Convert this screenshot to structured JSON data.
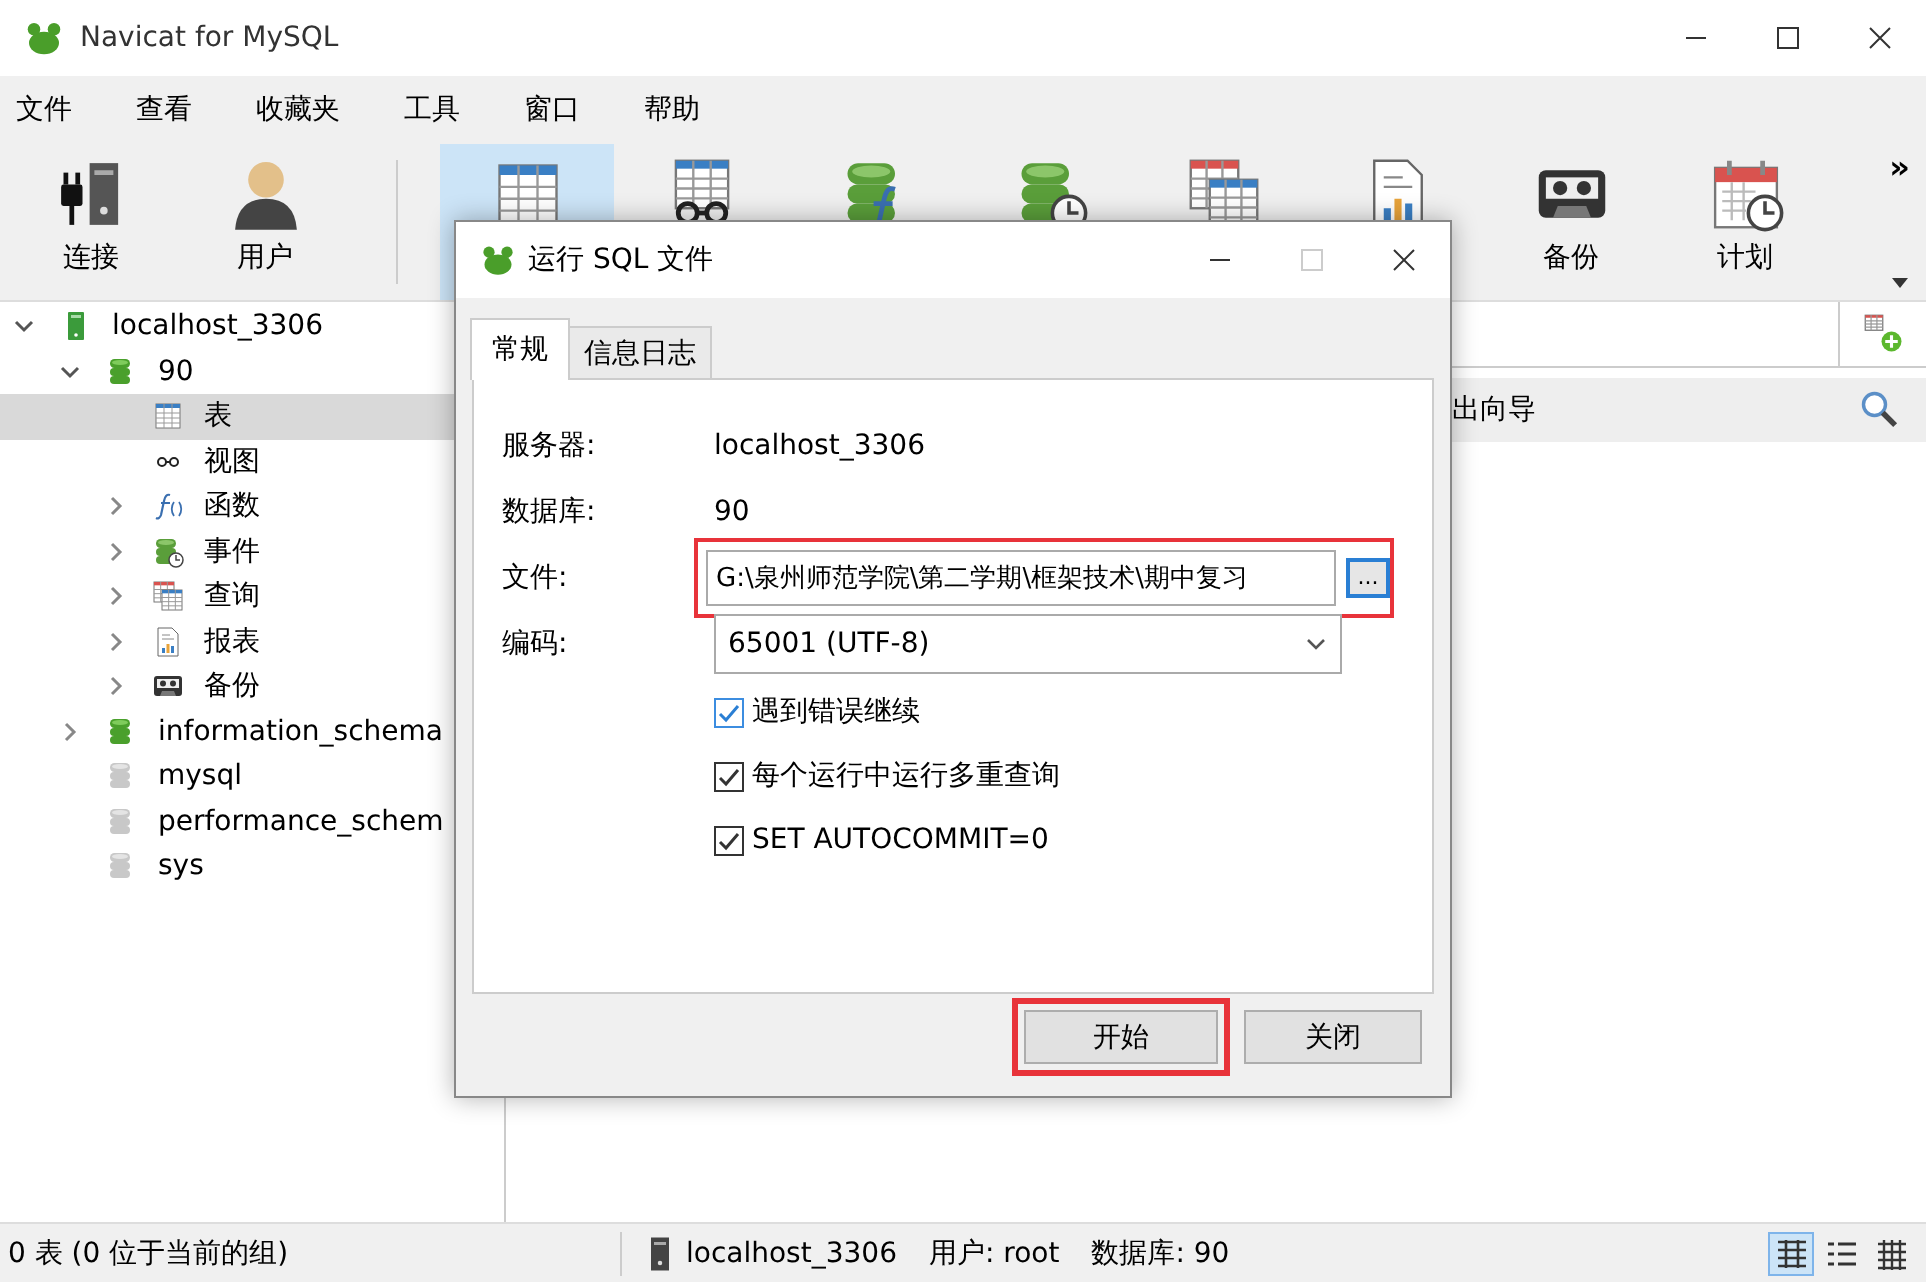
{
  "window": {
    "title": "Navicat for MySQL"
  },
  "menu": [
    "文件",
    "查看",
    "收藏夹",
    "工具",
    "窗口",
    "帮助"
  ],
  "toolbar": {
    "items": [
      {
        "kind": "connection",
        "label": "连接",
        "selected": false
      },
      {
        "kind": "user",
        "label": "用户",
        "selected": false
      },
      {
        "kind": "table",
        "selected": true
      },
      {
        "kind": "view",
        "selected": false
      },
      {
        "kind": "function",
        "selected": false
      },
      {
        "kind": "event",
        "selected": false
      },
      {
        "kind": "query",
        "selected": false
      },
      {
        "kind": "report",
        "selected": false
      },
      {
        "kind": "backup",
        "label": "备份",
        "selected": false
      },
      {
        "kind": "schedule",
        "label": "计划",
        "selected": false
      }
    ],
    "overflow": "»"
  },
  "tree": [
    {
      "label": "localhost_3306",
      "kind": "server",
      "expanded": true,
      "selected": false,
      "children": [
        {
          "label": "90",
          "kind": "database",
          "expanded": true,
          "selected": false,
          "children": [
            {
              "label": "表",
              "kind": "table",
              "selected": true
            },
            {
              "label": "视图",
              "kind": "view",
              "selected": false
            },
            {
              "label": "函数",
              "kind": "function",
              "expanded": false,
              "selected": false
            },
            {
              "label": "事件",
              "kind": "event",
              "expanded": false,
              "selected": false
            },
            {
              "label": "查询",
              "kind": "query",
              "expanded": false,
              "selected": false
            },
            {
              "label": "报表",
              "kind": "report",
              "expanded": false,
              "selected": false
            },
            {
              "label": "备份",
              "kind": "backup",
              "expanded": false,
              "selected": false
            }
          ]
        },
        {
          "label": "information_schema",
          "kind": "database",
          "expanded": false,
          "selected": false
        },
        {
          "label": "mysql",
          "kind": "database-closed",
          "selected": false
        },
        {
          "label": "performance_schem",
          "kind": "database-closed",
          "selected": false
        },
        {
          "label": "sys",
          "kind": "database-closed",
          "selected": false
        }
      ]
    }
  ],
  "object_bar": {
    "label": "出向导"
  },
  "dialog": {
    "title": "运行 SQL 文件",
    "tabs": [
      {
        "label": "常规",
        "selected": true
      },
      {
        "label": "信息日志",
        "selected": false
      }
    ],
    "fields": [
      {
        "kind": "text",
        "label": "服务器:",
        "value": "localhost_3306",
        "highlighted": false
      },
      {
        "kind": "text",
        "label": "数据库:",
        "value": "90",
        "highlighted": false
      },
      {
        "kind": "file",
        "label": "文件:",
        "value": "G:\\泉州师范学院\\第二学期\\框架技术\\期中复习",
        "browse": "...",
        "highlighted": true
      },
      {
        "kind": "select",
        "label": "编码:",
        "value": "65001 (UTF-8)",
        "highlighted": false
      }
    ],
    "options": [
      {
        "label": "遇到错误继续",
        "checked": true,
        "focused": true
      },
      {
        "label": "每个运行中运行多重查询",
        "checked": true,
        "focused": false
      },
      {
        "label": "SET AUTOCOMMIT=0",
        "checked": true,
        "focused": false
      }
    ],
    "buttons": [
      {
        "label": "开始",
        "highlighted": true
      },
      {
        "label": "关闭",
        "highlighted": false
      }
    ]
  },
  "status_bar": {
    "summary": "0 表 (0 位于当前的组)",
    "connection": "localhost_3306",
    "user": "用户: root",
    "database": "数据库: 90",
    "views": [
      {
        "kind": "grid",
        "selected": true
      },
      {
        "kind": "list",
        "selected": false
      },
      {
        "kind": "detail",
        "selected": false
      }
    ]
  }
}
